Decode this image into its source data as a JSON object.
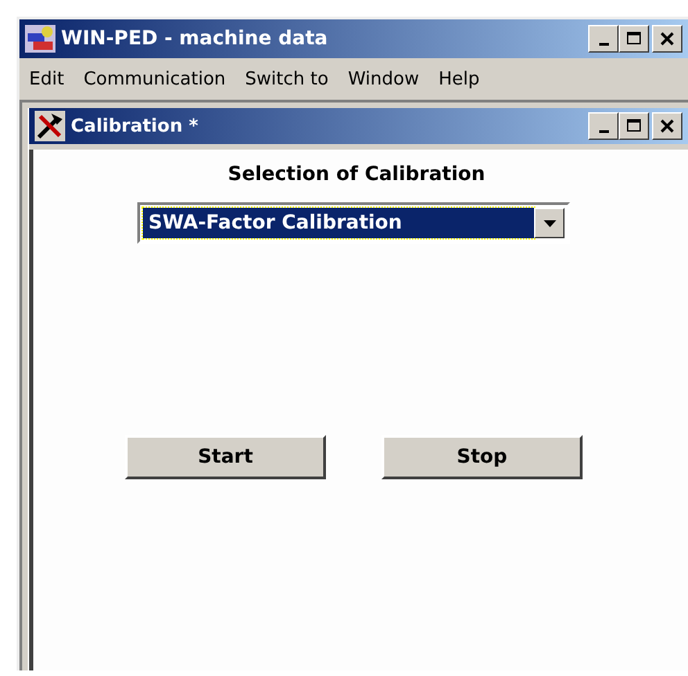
{
  "window": {
    "title": "WIN-PED -  machine data"
  },
  "menu": [
    "Edit",
    "Communication",
    "Switch to",
    "Window",
    "Help"
  ],
  "child_window": {
    "title": "Calibration *",
    "heading": "Selection of Calibration",
    "dropdown": {
      "value": "SWA-Factor Calibration",
      "selected": true
    },
    "buttons": [
      "Start",
      "Stop"
    ]
  }
}
